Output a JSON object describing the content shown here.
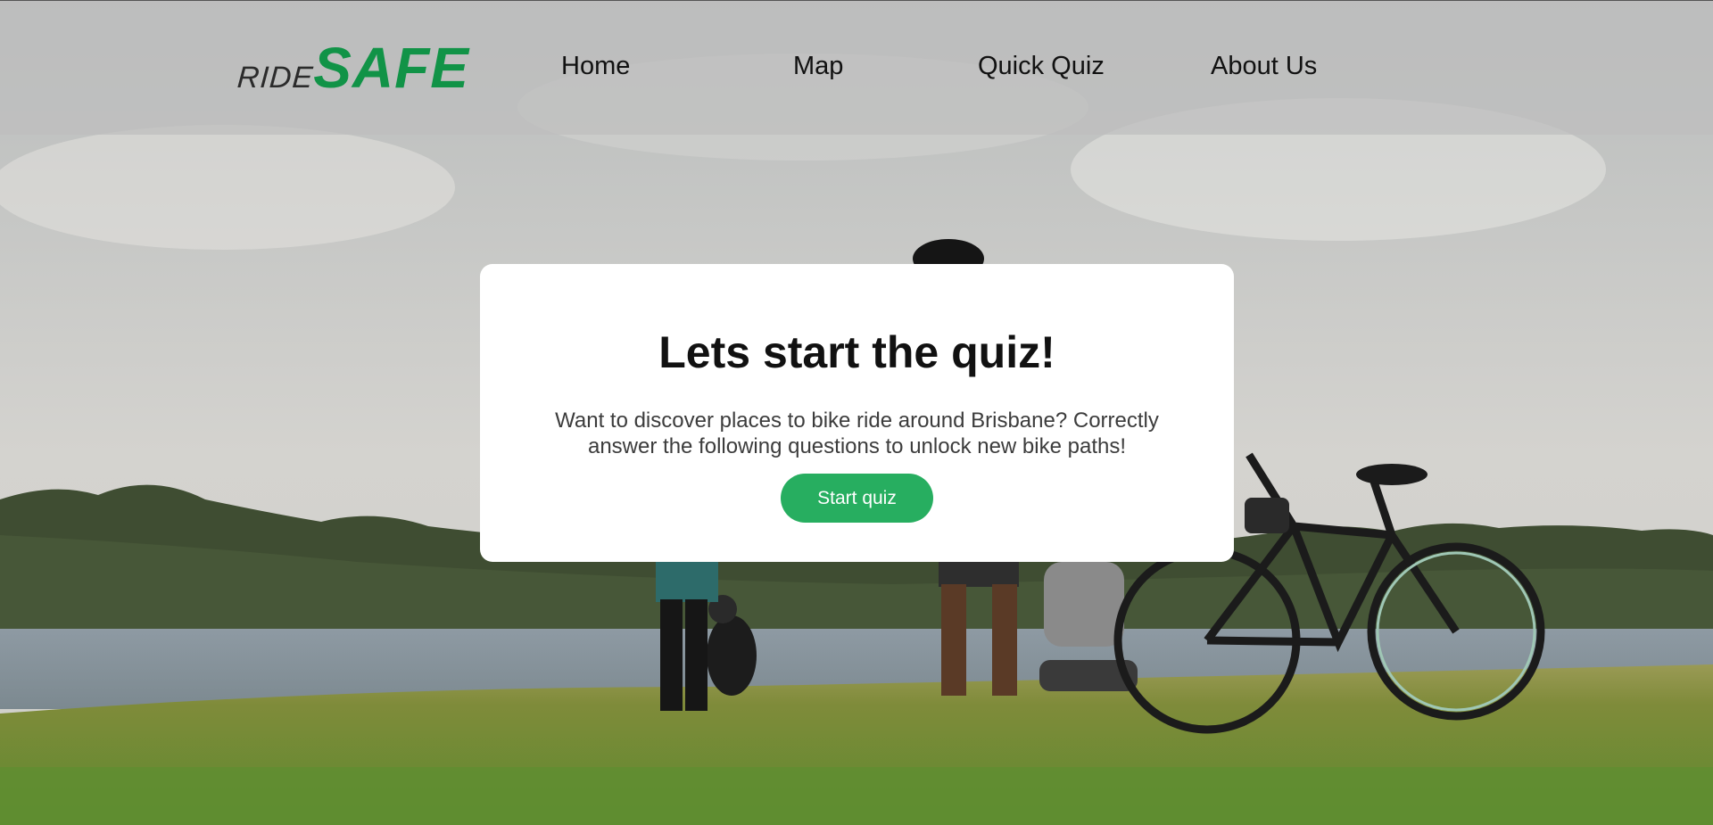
{
  "brand": {
    "logo_small": "RIDE",
    "logo_large": "SAFE",
    "accent_color": "#119347"
  },
  "nav": {
    "items": [
      {
        "label": "Home"
      },
      {
        "label": "Map"
      },
      {
        "label": "Quick Quiz"
      },
      {
        "label": "About Us"
      }
    ]
  },
  "quiz_card": {
    "title": "Lets start the quiz!",
    "description": "Want to discover places to bike ride around Brisbane? Correctly answer the following questions to unlock new bike paths!",
    "button_label": "Start quiz",
    "button_color": "#27ae60"
  },
  "background": {
    "icon": "park-photo-icon"
  }
}
